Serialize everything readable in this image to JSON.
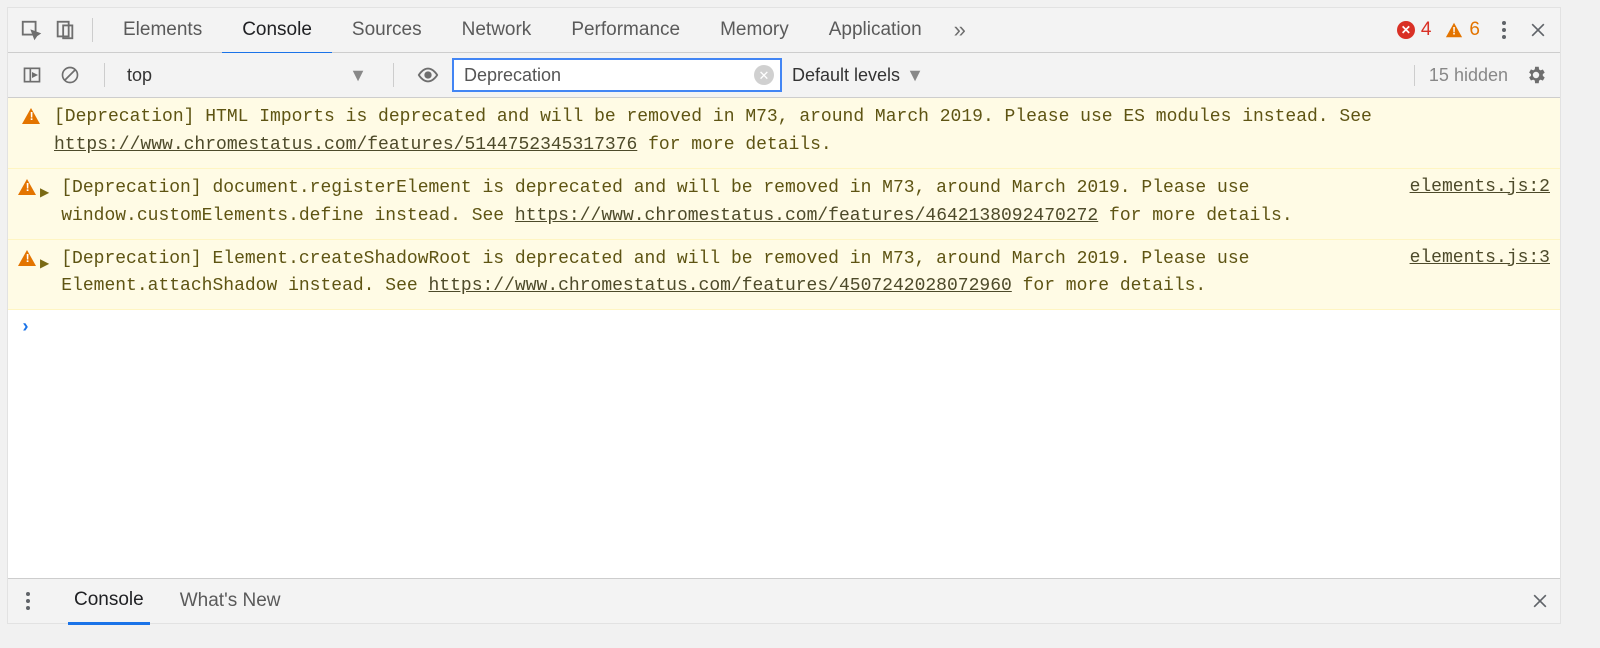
{
  "tabs": {
    "items": [
      "Elements",
      "Console",
      "Sources",
      "Network",
      "Performance",
      "Memory",
      "Application"
    ],
    "active_index": 1,
    "overflow_glyph": "»"
  },
  "status": {
    "error_count": "4",
    "warning_count": "6"
  },
  "console_toolbar": {
    "context_label": "top",
    "filter_value": "Deprecation",
    "levels_label": "Default levels",
    "hidden_label": "15 hidden"
  },
  "messages": [
    {
      "expandable": false,
      "text_before_link": "[Deprecation] HTML Imports is deprecated and will be removed in M73, around March 2019. Please use ES modules instead. See ",
      "link": "https://www.chromestatus.com/features/5144752345317376",
      "text_after_link": " for more details.",
      "source": ""
    },
    {
      "expandable": true,
      "text_before_link": "[Deprecation] document.registerElement is deprecated and will be removed in M73, around March 2019. Please use window.customElements.define instead. See ",
      "link": "https://www.chromestatus.com/features/4642138092470272",
      "text_after_link": " for more details.",
      "source": "elements.js:2"
    },
    {
      "expandable": true,
      "text_before_link": "[Deprecation] Element.createShadowRoot is deprecated and will be removed in M73, around March 2019. Please use Element.attachShadow instead. See ",
      "link": "https://www.chromestatus.com/features/4507242028072960",
      "text_after_link": " for more details.",
      "source": "elements.js:3"
    }
  ],
  "prompt_glyph": "›",
  "drawer": {
    "tabs": [
      "Console",
      "What's New"
    ],
    "active_index": 0
  }
}
